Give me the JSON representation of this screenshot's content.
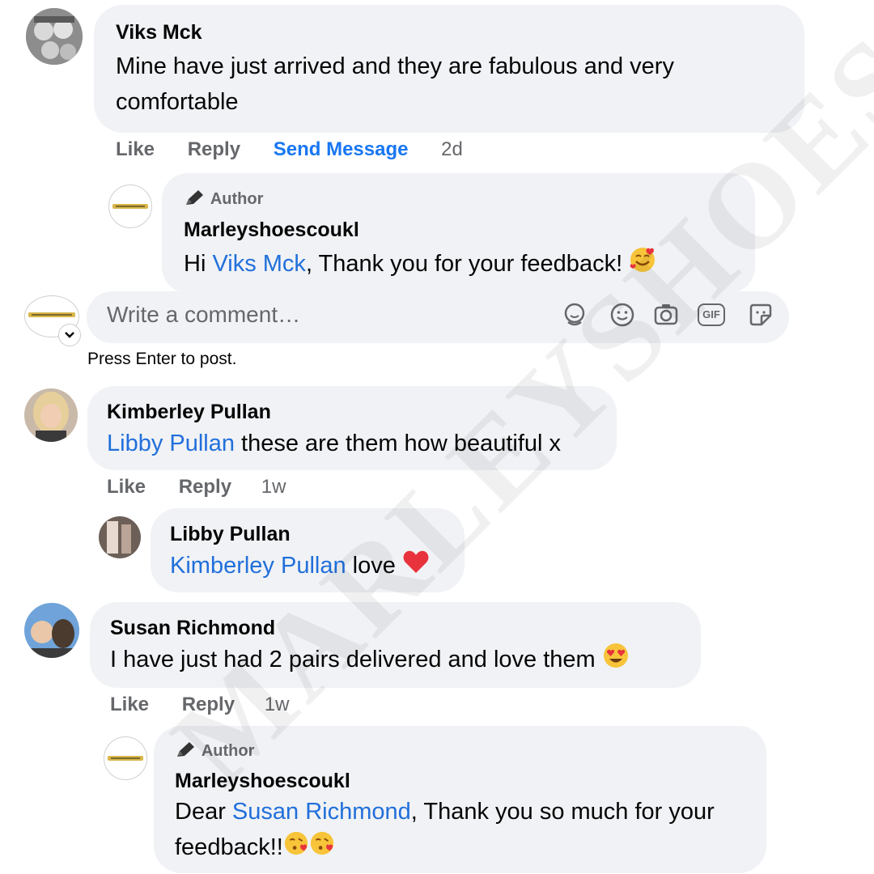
{
  "colors": {
    "bubble": "#f0f2f5",
    "mention": "#216fdb",
    "send_message": "#1877f2",
    "meta_text": "#65676b"
  },
  "watermark": "MARLEYSHOES",
  "comment1": {
    "name": "Viks Mck",
    "text": "Mine have just arrived and they are fabulous and very comfortable",
    "actions": {
      "like": "Like",
      "reply": "Reply",
      "send_message": "Send Message",
      "time": "2d"
    }
  },
  "reply1": {
    "author_tag": "Author",
    "name": "Marleyshoescoukl",
    "greeting": "Hi ",
    "mention": "Viks Mck",
    "text": ", Thank you for your feedback! "
  },
  "composer": {
    "placeholder": "Write a comment…",
    "icons": [
      "avatar-sticker-icon",
      "emoji-icon",
      "camera-icon",
      "gif-icon",
      "sticker-icon"
    ],
    "gif_label": "GIF",
    "hint": "Press Enter to post."
  },
  "comment2": {
    "name": "Kimberley Pullan",
    "mention": "Libby Pullan",
    "text": " these are them how beautiful x",
    "actions": {
      "like": "Like",
      "reply": "Reply",
      "time": "1w"
    }
  },
  "reply2": {
    "name": "Libby Pullan",
    "mention": "Kimberley Pullan",
    "text": " love "
  },
  "comment3": {
    "name": "Susan Richmond",
    "text": "I have just had 2 pairs delivered and love them ",
    "actions": {
      "like": "Like",
      "reply": "Reply",
      "time": "1w"
    }
  },
  "reply3": {
    "author_tag": "Author",
    "name": "Marleyshoescoukl",
    "greeting": "Dear ",
    "mention": "Susan Richmond",
    "text": ", Thank you so much for your feedback!!"
  }
}
